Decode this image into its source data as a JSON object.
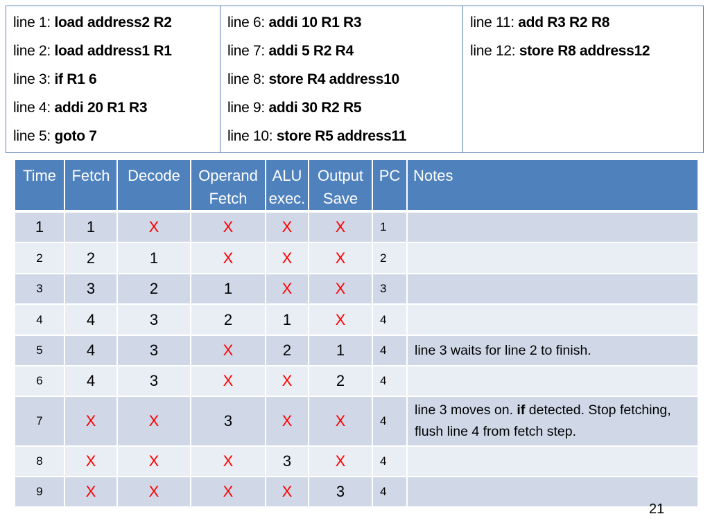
{
  "program": {
    "columns": [
      [
        {
          "label": "line 1: ",
          "instr": "load address2 R2"
        },
        {
          "label": "line 2: ",
          "instr": "load address1 R1"
        },
        {
          "label": "line 3: ",
          "instr": "if R1 6"
        },
        {
          "label": "line 4: ",
          "instr": "addi 20 R1 R3"
        },
        {
          "label": "line 5: ",
          "instr": "goto 7"
        }
      ],
      [
        {
          "label": "line 6: ",
          "instr": "addi 10 R1 R3"
        },
        {
          "label": "line 7: ",
          "instr": "addi 5 R2 R4"
        },
        {
          "label": "line 8: ",
          "instr": "store R4 address10"
        },
        {
          "label": "line 9: ",
          "instr": "addi 30 R2 R5"
        },
        {
          "label": "line 10: ",
          "instr": "store R5 address11"
        }
      ],
      [
        {
          "label": "line 11: ",
          "instr": "add R3 R2 R8"
        },
        {
          "label": "line 12: ",
          "instr": "store R8 address12"
        }
      ]
    ]
  },
  "table": {
    "headers": [
      "Time",
      "Fetch",
      "Decode",
      "Operand Fetch",
      "ALU exec.",
      "Output Save",
      "PC",
      "Notes"
    ],
    "header_lines": [
      [
        "Time"
      ],
      [
        "Fetch"
      ],
      [
        "Decode"
      ],
      [
        "Operand",
        "Fetch"
      ],
      [
        "ALU",
        "exec."
      ],
      [
        "Output",
        "Save"
      ],
      [
        "PC"
      ],
      [
        "Notes"
      ]
    ],
    "rows": [
      {
        "time": "1",
        "fetch": "1",
        "decode": "X",
        "operand": "X",
        "alu": "X",
        "output": "X",
        "pc": "1",
        "notes": ""
      },
      {
        "time": "2",
        "fetch": "2",
        "decode": "1",
        "operand": "X",
        "alu": "X",
        "output": "X",
        "pc": "2",
        "notes": ""
      },
      {
        "time": "3",
        "fetch": "3",
        "decode": "2",
        "operand": "1",
        "alu": "X",
        "output": "X",
        "pc": "3",
        "notes": ""
      },
      {
        "time": "4",
        "fetch": "4",
        "decode": "3",
        "operand": "2",
        "alu": "1",
        "output": "X",
        "pc": "4",
        "notes": ""
      },
      {
        "time": "5",
        "fetch": "4",
        "decode": "3",
        "operand": "X",
        "alu": "2",
        "output": "1",
        "pc": "4",
        "notes": "line 3 waits for line 2 to finish."
      },
      {
        "time": "6",
        "fetch": "4",
        "decode": "3",
        "operand": "X",
        "alu": "X",
        "output": "2",
        "pc": "4",
        "notes": ""
      },
      {
        "time": "7",
        "fetch": "X",
        "decode": "X",
        "operand": "3",
        "alu": "X",
        "output": "X",
        "pc": "4",
        "notes_parts": [
          {
            "text": "line 3 moves on. ",
            "bold": false
          },
          {
            "text": "if",
            "bold": true
          },
          {
            "text": " detected. Stop fetching, flush line 4 from fetch step.",
            "bold": false
          }
        ]
      },
      {
        "time": "8",
        "fetch": "X",
        "decode": "X",
        "operand": "X",
        "alu": "3",
        "output": "X",
        "pc": "4",
        "notes": ""
      },
      {
        "time": "9",
        "fetch": "X",
        "decode": "X",
        "operand": "X",
        "alu": "X",
        "output": "3",
        "pc": "4",
        "notes": ""
      }
    ]
  },
  "colors": {
    "header_bg": "#4f81bd",
    "row_odd": "#d0d8e8",
    "row_even": "#e9edf4",
    "x_mark": "#ff0000",
    "border": "#5a82b8"
  },
  "page_number": "21"
}
